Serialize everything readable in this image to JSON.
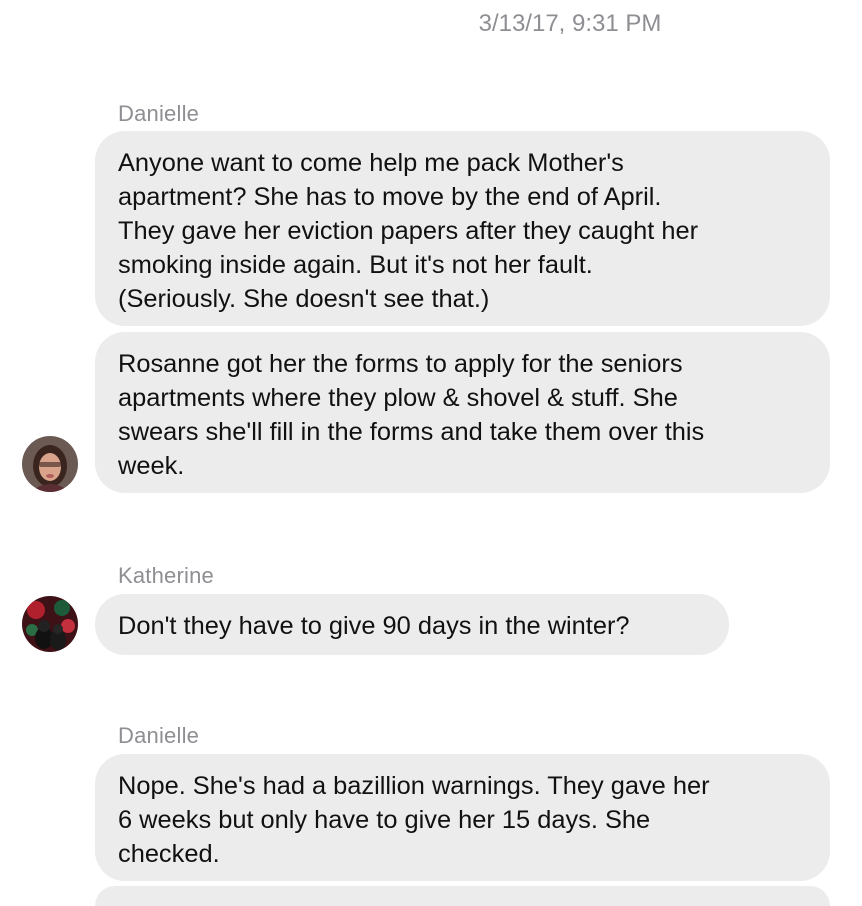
{
  "conversation": {
    "timestamp": "3/13/17, 9:31 PM",
    "groups": [
      {
        "sender": "Danielle",
        "messages": [
          "Anyone want to come help me pack Mother's\napartment? She has to move by the end of April.\nThey gave her eviction papers after they caught her\nsmoking inside again. But it's not her fault.\n(Seriously. She doesn't see that.)",
          "Rosanne got her the forms to apply for the seniors\napartments where they plow & shovel & stuff. She\nswears she'll fill in the forms and take them over this\nweek."
        ]
      },
      {
        "sender": "Katherine",
        "messages": [
          "Don't they have to give 90 days in the winter?"
        ]
      },
      {
        "sender": "Danielle",
        "messages": [
          "Nope. She's had a bazillion warnings. They gave her\n6 weeks but only have to give her 15 days. She\nchecked."
        ]
      }
    ]
  },
  "colors": {
    "bubble_bg": "#ececec",
    "name_text": "#8e8e93",
    "message_text": "#111111"
  }
}
